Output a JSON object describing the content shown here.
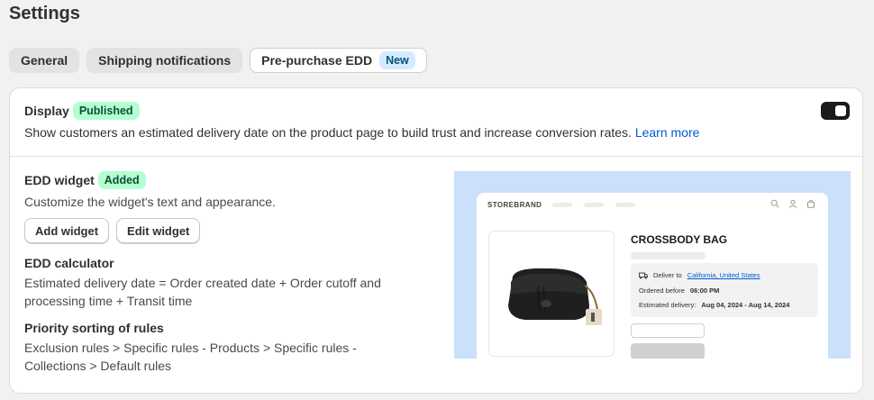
{
  "page": {
    "title": "Settings"
  },
  "tabs": [
    {
      "label": "General"
    },
    {
      "label": "Shipping notifications"
    },
    {
      "label": "Pre-purchase EDD",
      "badge": "New",
      "active": true
    }
  ],
  "display": {
    "title": "Display",
    "status": "Published",
    "description": "Show customers an estimated delivery date on the product page to build trust and increase conversion rates.",
    "learn_more": "Learn more",
    "enabled": true
  },
  "widget": {
    "title": "EDD widget",
    "status": "Added",
    "description": "Customize the widget's text and appearance.",
    "add_label": "Add widget",
    "edit_label": "Edit widget"
  },
  "calculator": {
    "title": "EDD calculator",
    "description": "Estimated delivery date = Order created date + Order cutoff and processing time + Transit time"
  },
  "priority": {
    "title": "Priority sorting of rules",
    "description": "Exclusion rules > Specific rules - Products > Specific rules - Collections > Default rules"
  },
  "preview": {
    "brand": "STOREBRAND",
    "product": "CROSSBODY BAG",
    "deliver_to_label": "Deliver to",
    "deliver_to_value": "California, United States",
    "ordered_before_label": "Ordered before",
    "ordered_before_value": "06:00 PM",
    "estimated_label": "Estimated delivery:",
    "estimated_value": "Aug 04, 2024 - Aug 14, 2024"
  },
  "colors": {
    "accent": "#005bd3",
    "badge_green": "#b4fed2",
    "badge_new": "#d6ebff",
    "preview_bg": "#cbe0fb"
  }
}
